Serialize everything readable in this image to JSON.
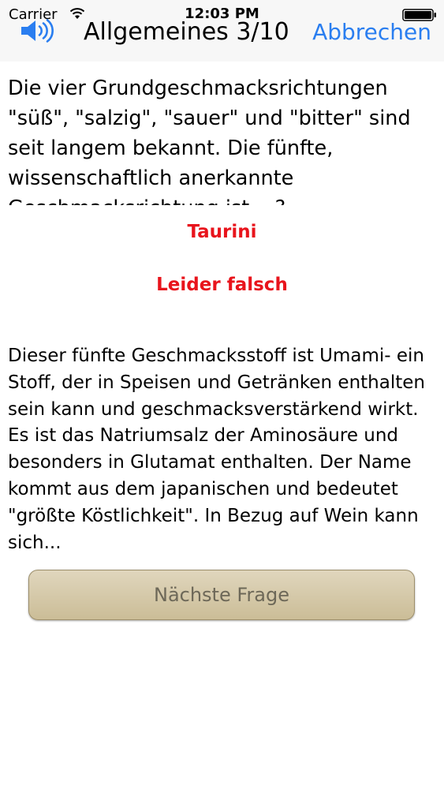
{
  "status_bar": {
    "carrier": "Carrier",
    "time": "12:03 PM"
  },
  "nav": {
    "title": "Allgemeines 3/10",
    "cancel_label": "Abbrechen"
  },
  "question": {
    "text": "Die vier Grundgeschmacksrichtungen \"süß\", \"salzig\", \"sauer\" und \"bitter\" sind seit langem bekannt. Die fünfte, wissenschaftlich anerkannte Geschmacksrichtung ist ...?"
  },
  "result": {
    "answer": "Taurini",
    "verdict": "Leider falsch"
  },
  "explanation": {
    "text": "Dieser fünfte Geschmacksstoff ist Umami- ein Stoff, der in Speisen und Getränken enthalten sein kann und geschmacksverstärkend wirkt. Es ist das Natriumsalz der Aminosäure und besonders in Glutamat enthalten. Der Name kommt aus dem japanischen und bedeutet \"größte Köstlichkeit\". In Bezug auf Wein kann sich..."
  },
  "next_button": {
    "label": "Nächste Frage"
  },
  "colors": {
    "accent_blue": "#2a7ef0",
    "wrong_red": "#e8141c",
    "button_gold": "#cbbd97"
  },
  "icons": {
    "speaker": "speaker-icon",
    "wifi": "wifi-icon",
    "battery": "battery-icon"
  }
}
